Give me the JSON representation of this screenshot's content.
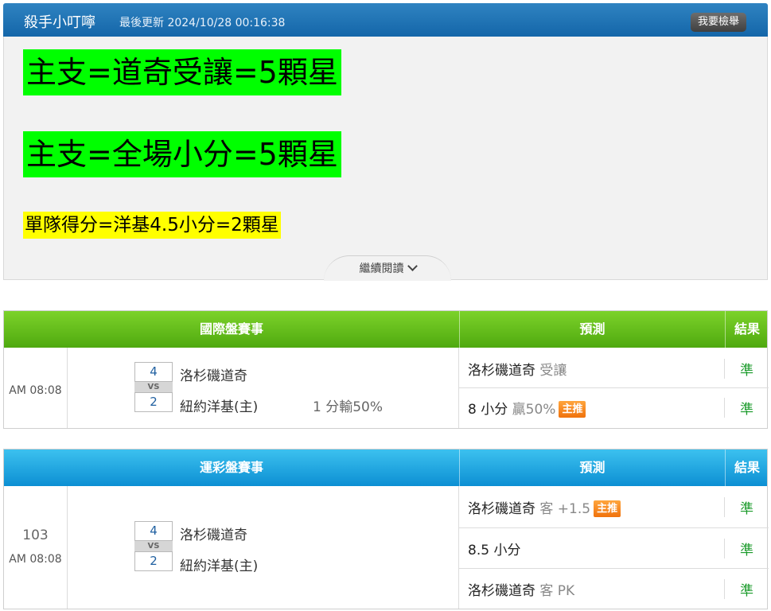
{
  "header": {
    "author": "殺手小叮嚀",
    "updated": "最後更新 2024/10/28 00:16:38",
    "report_label": "我要檢舉"
  },
  "article": {
    "line1": "主支=道奇受讓=5顆星",
    "line2": "主支=全場小分=5顆星",
    "line3": "單隊得分=洋基4.5小分=2顆星",
    "read_more": "繼續閱讀"
  },
  "international": {
    "headers": {
      "event": "國際盤賽事",
      "prediction": "預測",
      "result": "結果"
    },
    "time": "AM 08:08",
    "match": {
      "away_score": "4",
      "home_score": "2",
      "vs": "VS",
      "away_team": "洛杉磯道奇",
      "home_team": "紐約洋基(主)",
      "handicap_result": "1 分輸50%"
    },
    "predictions": [
      {
        "pick": "洛杉磯道奇",
        "detail": "受讓",
        "badge": "",
        "result": "準"
      },
      {
        "pick": "8 小分",
        "detail": "贏50%",
        "badge": "主推",
        "result": "準"
      }
    ]
  },
  "sports_lottery": {
    "headers": {
      "event": "運彩盤賽事",
      "prediction": "預測",
      "result": "結果"
    },
    "game_no": "103",
    "time": "AM 08:08",
    "match": {
      "away_score": "4",
      "home_score": "2",
      "vs": "VS",
      "away_team": "洛杉磯道奇",
      "home_team": "紐約洋基(主)"
    },
    "predictions": [
      {
        "pick": "洛杉磯道奇",
        "detail": "客 +1.5",
        "badge": "主推",
        "result": "準"
      },
      {
        "pick": "8.5 小分",
        "detail": "",
        "badge": "",
        "result": "準"
      },
      {
        "pick": "洛杉磯道奇",
        "detail": "客 PK",
        "badge": "",
        "result": "準"
      }
    ]
  },
  "colors": {
    "header_blue": "#1466a9",
    "green_header": "#5cb717",
    "blue_header": "#12a0dd",
    "highlight_green": "#00ff00",
    "highlight_yellow": "#ffff00",
    "result_green": "#1a9a2a",
    "badge_orange": "#f0720c"
  }
}
